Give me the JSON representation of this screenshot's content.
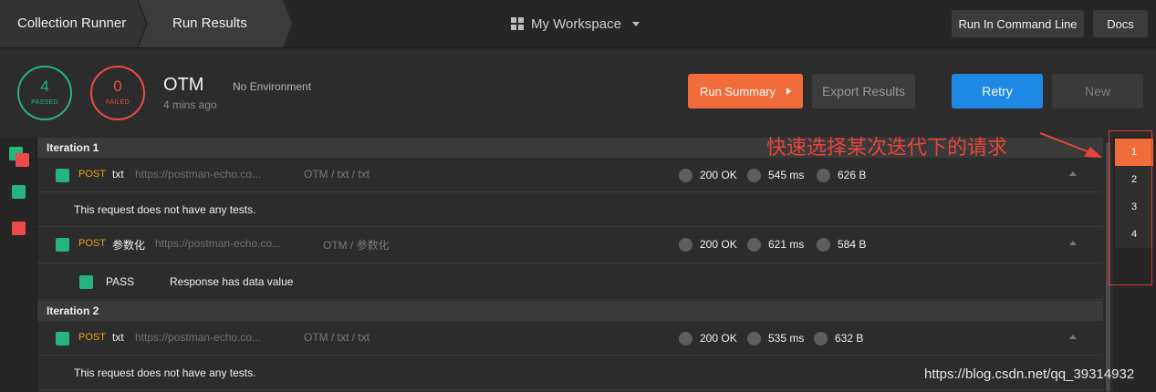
{
  "breadcrumb": [
    "Collection Runner",
    "Run Results"
  ],
  "workspace": {
    "label": "My Workspace"
  },
  "header_buttons": {
    "command_line": "Run In Command Line",
    "docs": "Docs"
  },
  "summary": {
    "passed": {
      "count": "4",
      "label": "PASSED"
    },
    "failed": {
      "count": "0",
      "label": "FAILED"
    },
    "collection_name": "OTM",
    "time_ago": "4 mins ago",
    "environment": "No Environment"
  },
  "actions": {
    "run_summary": "Run Summary",
    "export": "Export Results",
    "retry": "Retry",
    "new": "New"
  },
  "iterations": [
    {
      "label": "Iteration 1",
      "requests": [
        {
          "method": "POST",
          "name": "txt",
          "url": "https://postman-echo.co...",
          "path": "OTM / txt / txt",
          "status": "200 OK",
          "time": "545 ms",
          "size": "626 B",
          "note": "This request does not have any tests."
        },
        {
          "method": "POST",
          "name": "参数化",
          "url": "https://postman-echo.co...",
          "path": "OTM / 参数化",
          "status": "200 OK",
          "time": "621 ms",
          "size": "584 B",
          "test_state": "PASS",
          "test_name": "Response has data value"
        }
      ]
    },
    {
      "label": "Iteration 2",
      "requests": [
        {
          "method": "POST",
          "name": "txt",
          "url": "https://postman-echo.co...",
          "path": "OTM / txt / txt",
          "status": "200 OK",
          "time": "535 ms",
          "size": "632 B",
          "note": "This request does not have any tests."
        }
      ]
    }
  ],
  "iteration_nav": [
    "1",
    "2",
    "3",
    "4"
  ],
  "annotation": "快速选择某次迭代下的请求",
  "watermark": "https://blog.csdn.net/qq_39314932",
  "colors": {
    "pass": "#26b47f",
    "fail": "#ed4b48",
    "accent": "#f26b3a",
    "primary": "#1e88e5",
    "method": "#e8a317",
    "annotation": "#e8453c"
  }
}
